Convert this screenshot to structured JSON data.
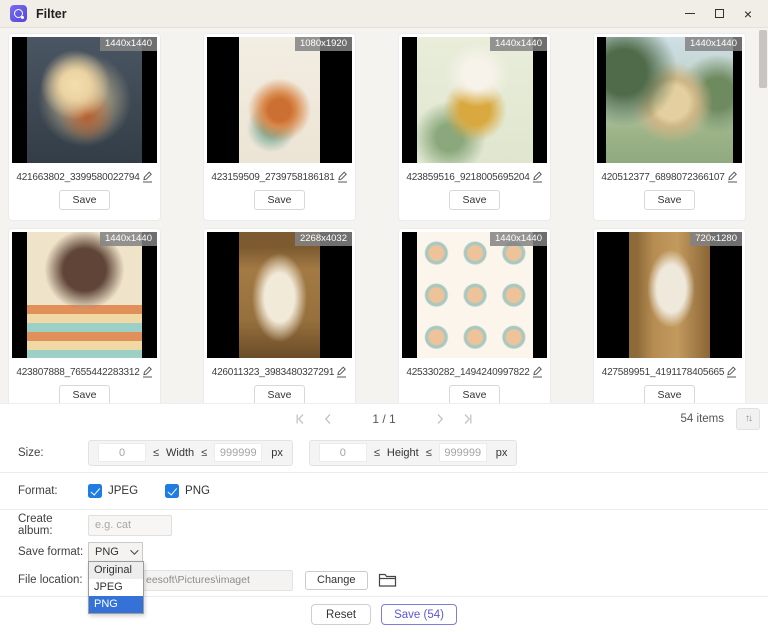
{
  "window": {
    "title": "Filter",
    "close_icon": "×"
  },
  "gallery": {
    "cards": [
      {
        "size": "1440x1440",
        "filename": "421663802_3399580022794",
        "save_label": "Save"
      },
      {
        "size": "1080x1920",
        "filename": "423159509_2739758186181",
        "save_label": "Save"
      },
      {
        "size": "1440x1440",
        "filename": "423859516_9218005695204",
        "save_label": "Save"
      },
      {
        "size": "1440x1440",
        "filename": "420512377_6898072366107",
        "save_label": "Save"
      },
      {
        "size": "1440x1440",
        "filename": "423807888_7655442283312",
        "save_label": "Save"
      },
      {
        "size": "2268x4032",
        "filename": "426011323_3983480327291",
        "save_label": "Save"
      },
      {
        "size": "1440x1440",
        "filename": "425330282_1494240997822",
        "save_label": "Save"
      },
      {
        "size": "720x1280",
        "filename": "427589951_4191178405665",
        "save_label": "Save"
      }
    ]
  },
  "pagination": {
    "page_indicator": "1 / 1",
    "items_count": "54 items",
    "sort_icon": "↑↓"
  },
  "filters": {
    "size": {
      "label": "Size:",
      "min_placeholder": "0",
      "max_placeholder": "999999",
      "lte": "≤",
      "width_label": "Width",
      "height_label": "Height",
      "unit": "px"
    },
    "format": {
      "label": "Format:",
      "options": [
        {
          "label": "JPEG",
          "checked": true
        },
        {
          "label": "PNG",
          "checked": true
        }
      ]
    },
    "create_album": {
      "label": "Create album:",
      "placeholder": "e.g. cat"
    },
    "save_format": {
      "label": "Save format:",
      "value": "PNG",
      "options": [
        "Original",
        "JPEG",
        "PNG"
      ]
    },
    "file_location": {
      "label": "File location:",
      "visible_path": "eesoft\\Pictures\\imaget",
      "change_label": "Change"
    }
  },
  "footer": {
    "reset_label": "Reset",
    "save_label": "Save (54)"
  }
}
